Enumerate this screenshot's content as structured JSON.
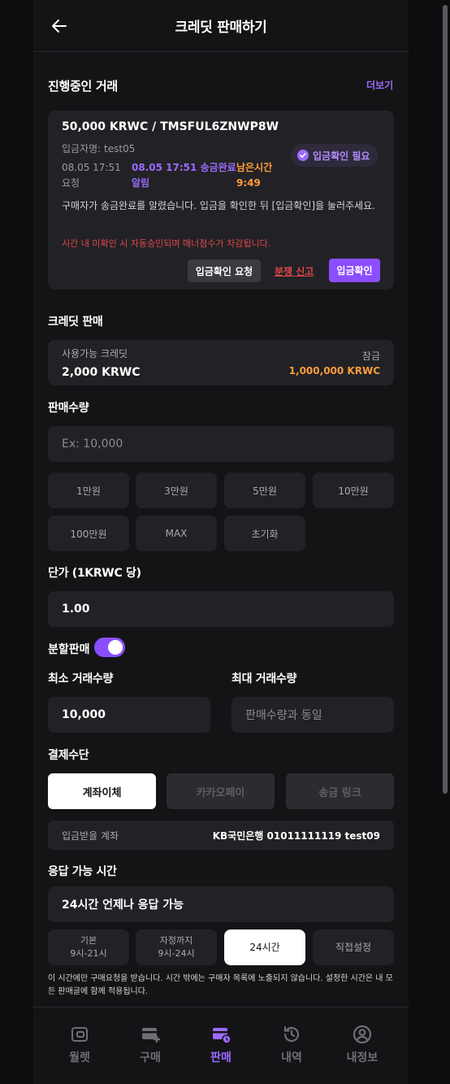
{
  "header": {
    "title": "크레딧 판매하기"
  },
  "ongoing": {
    "title": "진행중인 거래",
    "more": "더보기",
    "trade": {
      "title": "50,000 KRWC / TMSFUL6ZNWP8W",
      "depositor": "입금자명: test05",
      "badge": "입금확인 필요",
      "status": [
        {
          "line1": "08.05 17:51",
          "line2": "요청"
        },
        {
          "line1": "08.05 17:51 송금완료",
          "line2": "알림"
        },
        {
          "line1": "남은시간",
          "line2": "9:49"
        }
      ],
      "description": "구매자가 송금완료를 알렸습니다. 입금을 확인한 뒤 [입금확인]을 눌러주세요.",
      "warning": "시간 내 미확인 시 자동승인되며 매너점수가 차감됩니다.",
      "request_btn": "입금확인 요청",
      "dispute_btn": "분쟁 신고",
      "confirm_btn": "입금확인"
    }
  },
  "credit": {
    "title": "크레딧 판매",
    "available_label": "사용가능 크레딧",
    "available_value": "2,000 KRWC",
    "lock_label": "잠금",
    "lock_value": "1,000,000 KRWC"
  },
  "quantity": {
    "title": "판매수량",
    "placeholder": "Ex: 10,000",
    "chips": [
      "1만원",
      "3만원",
      "5만원",
      "10만원",
      "100만원",
      "MAX",
      "초기화"
    ]
  },
  "price": {
    "title": "단가 (1KRWC 당)",
    "value": "1.00"
  },
  "split": {
    "label": "분할판매",
    "on": true
  },
  "min_qty": {
    "title": "최소 거래수량",
    "value": "10,000"
  },
  "max_qty": {
    "title": "최대 거래수량",
    "placeholder": "판매수량과 동일"
  },
  "payment": {
    "title": "결제수단",
    "options": [
      "계좌이체",
      "카카오페이",
      "송금 링크"
    ],
    "account_label": "입금받을 계좌",
    "account_value": "KB국민은행 01011111119 test09"
  },
  "response_time": {
    "title": "응답 가능 시간",
    "value": "24시간 언제나 응답 가능",
    "options": [
      {
        "line1": "기본",
        "line2": "9시-21시"
      },
      {
        "line1": "자정까지",
        "line2": "9시-24시"
      },
      {
        "line1": "24시간",
        "line2": ""
      },
      {
        "line1": "직접설정",
        "line2": ""
      }
    ],
    "note": "이 시간에만 구매요청을 받습니다. 시간 밖에는 구매자 목록에 노출되지 않습니다. 설정한 시간은 내 모든 판매글에 함께 적용됩니다."
  },
  "nav": {
    "items": [
      "월렛",
      "구매",
      "판매",
      "내역",
      "내정보"
    ],
    "active": "판매"
  },
  "colors": {
    "accent": "#8c4dff",
    "warning": "#e04848",
    "orange": "#ff9c3a",
    "bg": "#141416",
    "surface": "#222226"
  }
}
